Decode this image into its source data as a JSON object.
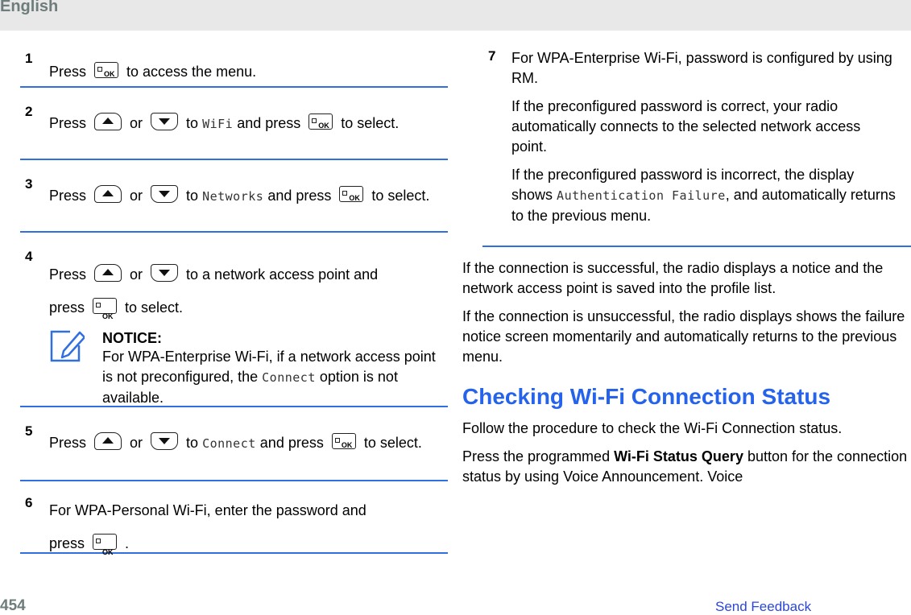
{
  "header": {
    "language": "English"
  },
  "keys": {
    "ok_label": "OK"
  },
  "steps": [
    {
      "num": "1",
      "parts": {
        "a": "Press",
        "b": "to access the menu."
      }
    },
    {
      "num": "2",
      "parts": {
        "a": "Press",
        "or": "or",
        "to": "to",
        "mono": "WiFi",
        "and": "and press",
        "end": "to select."
      }
    },
    {
      "num": "3",
      "parts": {
        "a": "Press",
        "or": "or",
        "to": "to",
        "mono": "Networks",
        "and": "and press",
        "end": "to select."
      }
    },
    {
      "num": "4",
      "parts": {
        "a": "Press",
        "or": "or",
        "rest": "to a network access point and",
        "press": "press",
        "end": "to select."
      },
      "notice": {
        "title": "NOTICE:",
        "body_a": "For WPA-Enterprise Wi-Fi, if a network access point is not preconfigured, the",
        "mono": "Connect",
        "body_b": "option is not available."
      }
    },
    {
      "num": "5",
      "parts": {
        "a": "Press",
        "or": "or",
        "to": "to",
        "mono": "Connect",
        "and": "and press",
        "end": "to select."
      }
    },
    {
      "num": "6",
      "parts": {
        "a": "For WPA-Personal Wi-Fi, enter the password and",
        "press": "press",
        "end": "."
      }
    }
  ],
  "step7": {
    "num": "7",
    "text": "For WPA-Enterprise Wi-Fi, password is configured by using RM.",
    "p1": "If the preconfigured password is correct, your radio automatically connects to the selected network access point.",
    "p2_a": "If the preconfigured password is incorrect, the display shows",
    "p2_mono": "Authentication Failure",
    "p2_b": ", and automatically returns to the previous menu."
  },
  "right": {
    "p_success": "If the connection is successful, the radio displays a notice and the network access point is saved into the profile list.",
    "p_fail": "If the connection is unsuccessful, the radio displays shows the failure notice screen momentarily and automatically returns to the previous menu.",
    "heading": "Checking Wi-Fi Connection Status",
    "p_follow": "Follow the procedure to check the Wi-Fi Connection status.",
    "p_press_a": "Press the programmed",
    "p_press_bold": "Wi-Fi Status Query",
    "p_press_b": "button for the connection status by using Voice Announcement. Voice"
  },
  "footer": {
    "page_number": "454",
    "feedback_link": "Send Feedback"
  },
  "colors": {
    "accent": "#2f6fe0",
    "heading": "#2563eb",
    "link": "#2b47d8",
    "gray": "#6f7c7c"
  }
}
